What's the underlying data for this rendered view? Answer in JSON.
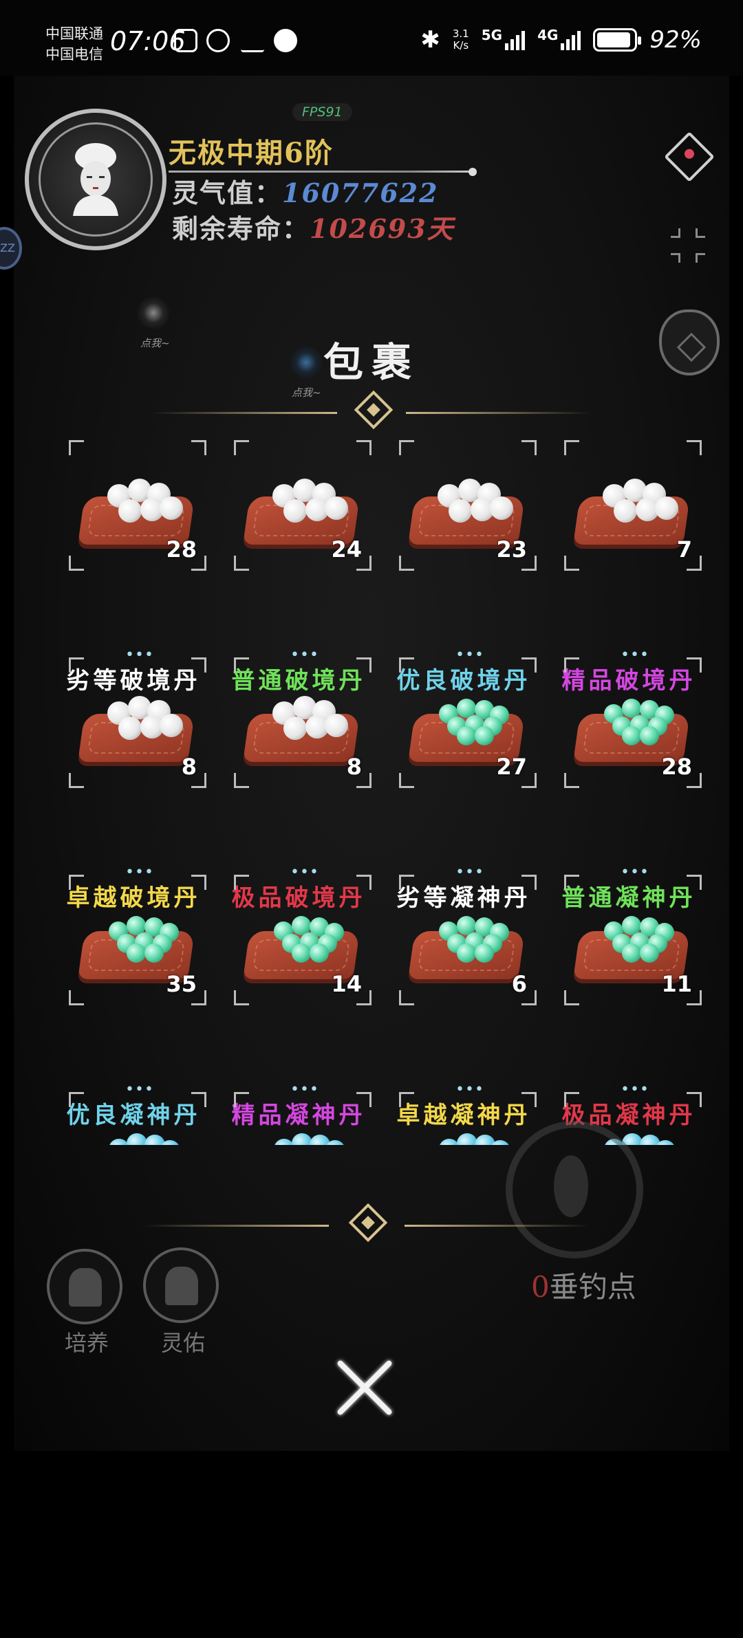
{
  "status_bar": {
    "carrier_1": "中国联通",
    "carrier_2": "中国电信",
    "time": "07:06",
    "net_speed_value": "3.1",
    "net_speed_unit": "K/s",
    "network_1": "5G",
    "network_2": "4G",
    "battery": "92%"
  },
  "hud": {
    "fps": "FPS91",
    "realm": "无极中期6阶",
    "qi_label": "灵气值：",
    "qi_value": "16077622",
    "life_label": "剩余寿命：",
    "life_value": "102693天",
    "side_badge": "ZZ",
    "hint_1": "点我~",
    "hint_2": "点我~"
  },
  "inventory": {
    "title": "包裹",
    "items": [
      {
        "name": "劣等破境丹",
        "count": "28",
        "color": "#ffffff",
        "pill": "white"
      },
      {
        "name": "普通破境丹",
        "count": "24",
        "color": "#6fe25a",
        "pill": "white"
      },
      {
        "name": "优良破境丹",
        "count": "23",
        "color": "#6fd3ea",
        "pill": "white"
      },
      {
        "name": "精品破境丹",
        "count": "7",
        "color": "#d447e0",
        "pill": "white"
      },
      {
        "name": "卓越破境丹",
        "count": "8",
        "color": "#f3d84a",
        "pill": "white"
      },
      {
        "name": "极品破境丹",
        "count": "8",
        "color": "#e2384a",
        "pill": "white"
      },
      {
        "name": "劣等凝神丹",
        "count": "27",
        "color": "#ffffff",
        "pill": "green"
      },
      {
        "name": "普通凝神丹",
        "count": "28",
        "color": "#6fe25a",
        "pill": "green"
      },
      {
        "name": "优良凝神丹",
        "count": "35",
        "color": "#6fd3ea",
        "pill": "green"
      },
      {
        "name": "精品凝神丹",
        "count": "14",
        "color": "#d447e0",
        "pill": "green"
      },
      {
        "name": "卓越凝神丹",
        "count": "6",
        "color": "#f3d84a",
        "pill": "green"
      },
      {
        "name": "极品凝神丹",
        "count": "11",
        "color": "#e2384a",
        "pill": "green"
      },
      {
        "name": "",
        "count": "",
        "color": "#ffffff",
        "pill": "blue"
      },
      {
        "name": "",
        "count": "",
        "color": "#ffffff",
        "pill": "blue"
      },
      {
        "name": "",
        "count": "",
        "color": "#ffffff",
        "pill": "blue"
      },
      {
        "name": "",
        "count": "",
        "color": "#ffffff",
        "pill": "blue"
      }
    ],
    "more_dots": "•••"
  },
  "bottom": {
    "fishing_count": "0",
    "fishing_label": "垂钓点",
    "cultivate_label": "培养",
    "blessing_label": "灵佑"
  }
}
